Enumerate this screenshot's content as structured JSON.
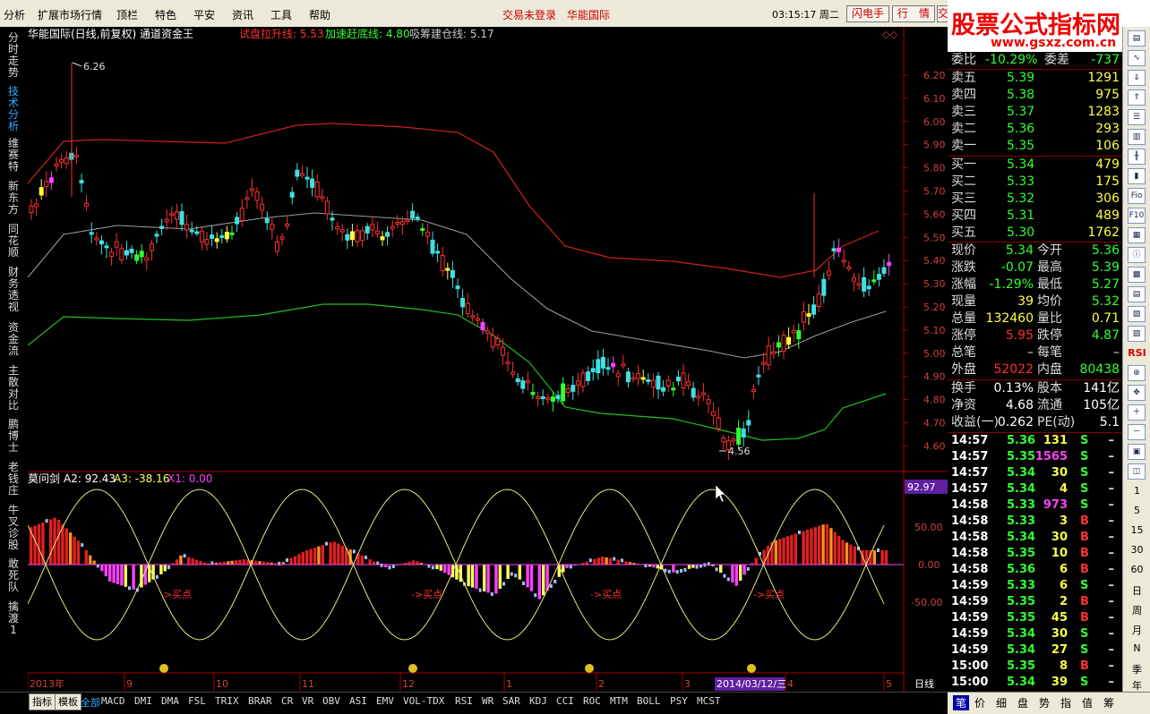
{
  "menu": [
    "分析",
    "扩展市场行情",
    "顶栏",
    "特色",
    "平安",
    "资讯",
    "工具",
    "帮助"
  ],
  "status": {
    "login": "交易未登录",
    "stock": "华能国际"
  },
  "clock": "03:15:17 周二",
  "top_buttons": [
    "闪电手",
    "行　情",
    "交　"
  ],
  "logo": {
    "title": "股票公式指标网",
    "url": "www.gsxz.com.cn"
  },
  "left_tabs": [
    "分时走势",
    "技术分析",
    "维赛特",
    "新东方",
    "同花顺",
    "财务透视",
    "资金流",
    "主散对比",
    "鹏博士",
    "老钱庄",
    "牛叉诊股",
    "敢死队",
    "擒渡1"
  ],
  "chart": {
    "header_title": "华能国际(日线,前复权) 通道资金王",
    "header_items": [
      {
        "label": "试盘拉升线: 5.53",
        "color": "#ff3030"
      },
      {
        "label": "加速赶底线: 4.80",
        "color": "#30ff30"
      },
      {
        "label": "吸筹建仓线: 5.17",
        "color": "#c8c8c8"
      }
    ],
    "price_ticks": [
      "6.20",
      "6.10",
      "6.00",
      "5.90",
      "5.80",
      "5.70",
      "5.60",
      "5.50",
      "5.40",
      "5.30",
      "5.20",
      "5.10",
      "5.00",
      "4.90",
      "4.80",
      "4.70",
      "4.60"
    ],
    "high_label": "6.26",
    "low_label": "4.56",
    "sub_title": "莫问剑",
    "sub_items": [
      {
        "label": "A2: 92.43",
        "color": "#ffffff"
      },
      {
        "label": "A3: -38.16",
        "color": "#ffff60"
      },
      {
        "label": "X1: 0.00",
        "color": "#ff40ff"
      }
    ],
    "sub_value_box": "92.97",
    "sub_ticks": [
      "50.00",
      "0.00",
      "-50.00"
    ],
    "buy_labels": [
      "->买点",
      "->买点",
      "->买点",
      "->买点"
    ],
    "x_labels": [
      "2013年",
      "9",
      "10",
      "11",
      "12",
      "1",
      "2",
      "3",
      "4",
      "5"
    ],
    "cursor_date": "2014/03/12/三",
    "period": "日线"
  },
  "quote": {
    "weibi": {
      "label": "委比",
      "value": "-10.29%",
      "label2": "委差",
      "value2": "-737"
    },
    "asks": [
      {
        "label": "卖五",
        "price": "5.39",
        "vol": "1291"
      },
      {
        "label": "卖四",
        "price": "5.38",
        "vol": "975"
      },
      {
        "label": "卖三",
        "price": "5.37",
        "vol": "1283"
      },
      {
        "label": "卖二",
        "price": "5.36",
        "vol": "293"
      },
      {
        "label": "卖一",
        "price": "5.35",
        "vol": "106"
      }
    ],
    "bids": [
      {
        "label": "买一",
        "price": "5.34",
        "vol": "479"
      },
      {
        "label": "买二",
        "price": "5.33",
        "vol": "175"
      },
      {
        "label": "买三",
        "price": "5.32",
        "vol": "306"
      },
      {
        "label": "买四",
        "price": "5.31",
        "vol": "489"
      },
      {
        "label": "买五",
        "price": "5.30",
        "vol": "1762"
      }
    ],
    "stats": [
      {
        "l1": "现价",
        "v1": "5.34",
        "c1": "#30ff30",
        "l2": "今开",
        "v2": "5.36",
        "c2": "#30ff30"
      },
      {
        "l1": "涨跌",
        "v1": "-0.07",
        "c1": "#30ff30",
        "l2": "最高",
        "v2": "5.39",
        "c2": "#30ff30"
      },
      {
        "l1": "涨幅",
        "v1": "-1.29%",
        "c1": "#30ff30",
        "l2": "最低",
        "v2": "5.27",
        "c2": "#30ff30"
      },
      {
        "l1": "现量",
        "v1": "39",
        "c1": "#ffff40",
        "l2": "均价",
        "v2": "5.32",
        "c2": "#30ff30"
      },
      {
        "l1": "总量",
        "v1": "132460",
        "c1": "#ffff40",
        "l2": "量比",
        "v2": "0.71",
        "c2": "#ffff40"
      },
      {
        "l1": "涨停",
        "v1": "5.95",
        "c1": "#ff3030",
        "l2": "跌停",
        "v2": "4.87",
        "c2": "#30ff30"
      },
      {
        "l1": "总笔",
        "v1": "–",
        "c1": "#ddd",
        "l2": "每笔",
        "v2": "–",
        "c2": "#ddd"
      },
      {
        "l1": "外盘",
        "v1": "52022",
        "c1": "#ff3030",
        "l2": "内盘",
        "v2": "80438",
        "c2": "#30ff30"
      }
    ],
    "fin": [
      {
        "l1": "换手",
        "v1": "0.13%",
        "l2": "股本",
        "v2": "141亿"
      },
      {
        "l1": "净资",
        "v1": "4.68",
        "l2": "流通",
        "v2": "105亿"
      },
      {
        "l1": "收益(一)",
        "v1": "0.262",
        "l2": "PE(动)",
        "v2": "5.1"
      }
    ],
    "ticks": [
      {
        "t": "14:57",
        "p": "5.36",
        "v": "131",
        "d": "S",
        "vc": "#ffff40"
      },
      {
        "t": "14:57",
        "p": "5.35",
        "v": "1565",
        "d": "S",
        "vc": "#ff40ff"
      },
      {
        "t": "14:57",
        "p": "5.34",
        "v": "30",
        "d": "S",
        "vc": "#ffff40"
      },
      {
        "t": "14:57",
        "p": "5.34",
        "v": "4",
        "d": "S",
        "vc": "#ffff40"
      },
      {
        "t": "14:58",
        "p": "5.33",
        "v": "973",
        "d": "S",
        "vc": "#ff40ff"
      },
      {
        "t": "14:58",
        "p": "5.33",
        "v": "3",
        "d": "B",
        "vc": "#ffff40"
      },
      {
        "t": "14:58",
        "p": "5.34",
        "v": "30",
        "d": "B",
        "vc": "#ffff40"
      },
      {
        "t": "14:58",
        "p": "5.35",
        "v": "10",
        "d": "B",
        "vc": "#ffff40"
      },
      {
        "t": "14:58",
        "p": "5.36",
        "v": "6",
        "d": "B",
        "vc": "#ffff40"
      },
      {
        "t": "14:59",
        "p": "5.33",
        "v": "6",
        "d": "S",
        "vc": "#ffff40"
      },
      {
        "t": "14:59",
        "p": "5.35",
        "v": "2",
        "d": "B",
        "vc": "#ffff40"
      },
      {
        "t": "14:59",
        "p": "5.35",
        "v": "45",
        "d": "B",
        "vc": "#ffff40"
      },
      {
        "t": "14:59",
        "p": "5.34",
        "v": "30",
        "d": "S",
        "vc": "#ffff40"
      },
      {
        "t": "14:59",
        "p": "5.34",
        "v": "27",
        "d": "S",
        "vc": "#ffff40"
      },
      {
        "t": "15:00",
        "p": "5.35",
        "v": "8",
        "d": "B",
        "vc": "#ffff40"
      },
      {
        "t": "15:00",
        "p": "5.34",
        "v": "39",
        "d": "S",
        "vc": "#ffff40"
      }
    ]
  },
  "right_toolbar_labels": [
    "RSI",
    "1",
    "5",
    "15",
    "30",
    "60",
    "日",
    "周",
    "月",
    "N",
    "季",
    "年"
  ],
  "bottom_tabs": [
    "指标",
    "模板",
    "全部",
    "MACD",
    "DMI",
    "DMA",
    "FSL",
    "TRIX",
    "BRAR",
    "CR",
    "VR",
    "OBV",
    "ASI",
    "EMV",
    "VOL-TDX",
    "RSI",
    "WR",
    "SAR",
    "KDJ",
    "CCI",
    "ROC",
    "MTM",
    "BOLL",
    "PSY",
    "MCST"
  ],
  "right_bottom_tabs": [
    "笔",
    "价",
    "细",
    "盘",
    "势",
    "指",
    "值",
    "筹"
  ]
}
